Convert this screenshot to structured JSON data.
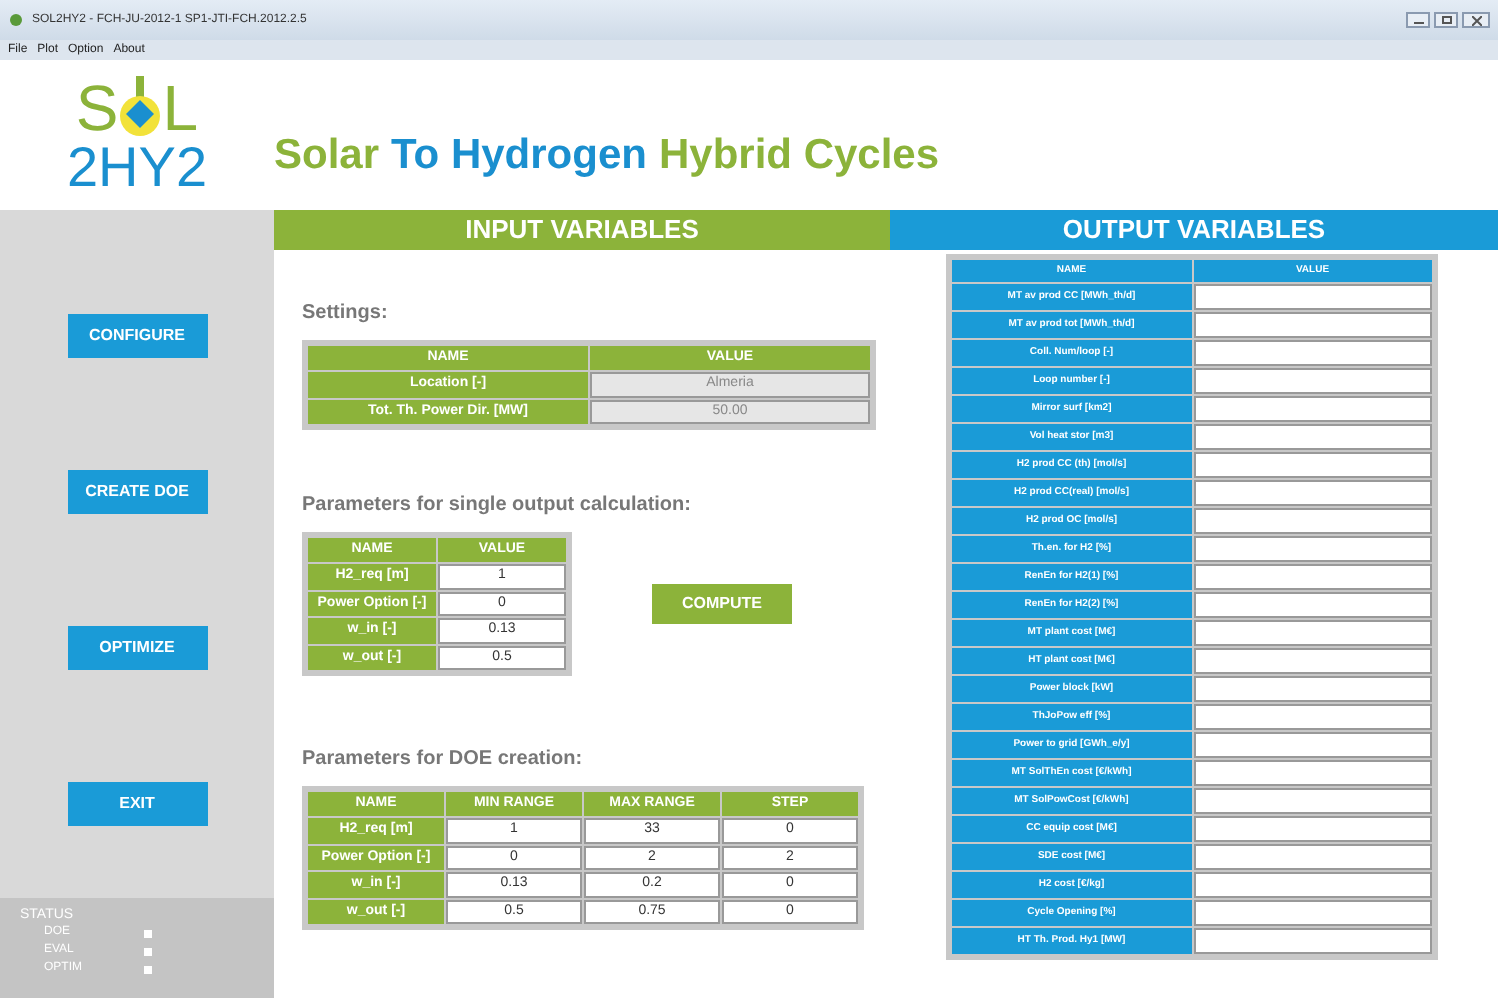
{
  "window": {
    "title": "SOL2HY2 - FCH-JU-2012-1 SP1-JTI-FCH.2012.2.5"
  },
  "menu": [
    "File",
    "Plot",
    "Option",
    "About"
  ],
  "logo": {
    "top_left": "S",
    "top_right": "L",
    "bottom": "2HY2"
  },
  "title": [
    {
      "text": "Solar",
      "color": "#8cb33a"
    },
    {
      "text": "To Hydrogen",
      "color": "#1a8fcf"
    },
    {
      "text": "Hybrid Cycles",
      "color": "#8cb33a"
    }
  ],
  "sidebar": {
    "buttons": [
      "CONFIGURE",
      "CREATE DOE",
      "OPTIMIZE",
      "EXIT"
    ],
    "status": {
      "title": "STATUS",
      "items": [
        "DOE",
        "EVAL",
        "OPTIM"
      ]
    }
  },
  "input": {
    "header": "INPUT VARIABLES",
    "settings": {
      "title": "Settings:",
      "columns": [
        "NAME",
        "VALUE"
      ],
      "rows": [
        [
          "Location [-]",
          "Almeria"
        ],
        [
          "Tot. Th. Power Dir. [MW]",
          "50.00"
        ]
      ]
    },
    "single": {
      "title": "Parameters for single output calculation:",
      "columns": [
        "NAME",
        "VALUE"
      ],
      "rows": [
        [
          "H2_req [m]",
          "1"
        ],
        [
          "Power Option [-]",
          "0"
        ],
        [
          "w_in [-]",
          "0.13"
        ],
        [
          "w_out [-]",
          "0.5"
        ]
      ],
      "button": "COMPUTE"
    },
    "doe": {
      "title": "Parameters for DOE creation:",
      "columns": [
        "NAME",
        "MIN RANGE",
        "MAX RANGE",
        "STEP"
      ],
      "rows": [
        [
          "H2_req [m]",
          "1",
          "33",
          "0"
        ],
        [
          "Power Option [-]",
          "0",
          "2",
          "2"
        ],
        [
          "w_in [-]",
          "0.13",
          "0.2",
          "0"
        ],
        [
          "w_out [-]",
          "0.5",
          "0.75",
          "0"
        ]
      ]
    }
  },
  "output": {
    "header": "OUTPUT VARIABLES",
    "columns": [
      "NAME",
      "VALUE"
    ],
    "rows": [
      "MT av prod CC [MWh_th/d]",
      "MT av prod tot [MWh_th/d]",
      "Coll. Num/loop [-]",
      "Loop number [-]",
      "Mirror surf [km2]",
      "Vol heat stor [m3]",
      "H2 prod CC (th) [mol/s]",
      "H2 prod CC(real) [mol/s]",
      "H2 prod OC  [mol/s]",
      "Th.en. for H2  [%]",
      "RenEn for H2(1) [%]",
      "RenEn for H2(2) [%]",
      "MT plant cost [M€]",
      "HT plant cost [M€]",
      "Power block [kW]",
      "ThJoPow eff [%]",
      "Power to grid  [GWh_e/y]",
      "MT SolThEn cost [€/kWh]",
      "MT SolPowCost [€/kWh]",
      "CC equip cost  [M€]",
      "SDE cost [M€]",
      "H2 cost [€/kg]",
      "Cycle Opening [%]",
      "HT Th. Prod. Hy1 [MW]"
    ]
  }
}
